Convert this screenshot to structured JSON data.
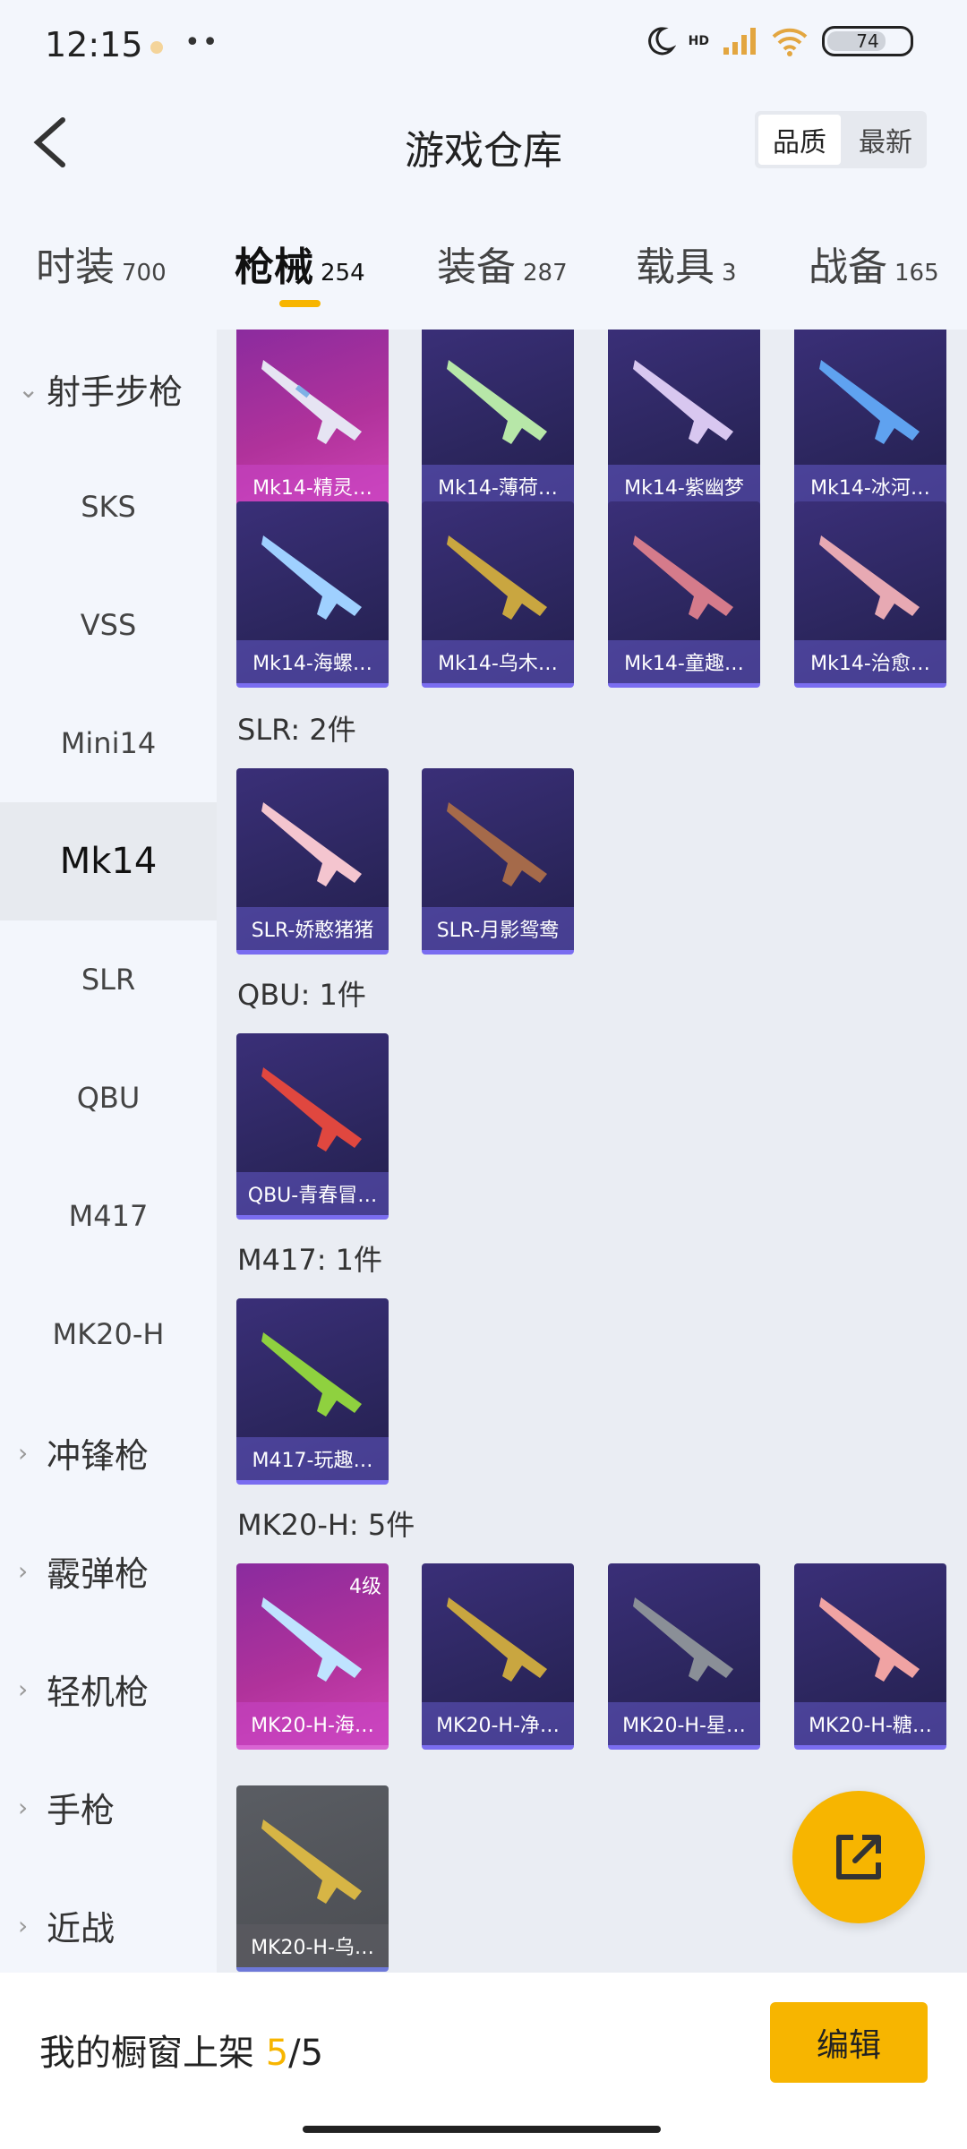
{
  "status_bar": {
    "time": "12:15",
    "network": "HD",
    "battery": "74",
    "battery_level": 0.74
  },
  "header": {
    "title": "游戏仓库",
    "sort_quality": "品质",
    "sort_latest": "最新"
  },
  "tabs": [
    {
      "label": "时装",
      "count": "700"
    },
    {
      "label": "枪械",
      "count": "254",
      "active": true
    },
    {
      "label": "装备",
      "count": "287"
    },
    {
      "label": "载具",
      "count": "3"
    },
    {
      "label": "战备",
      "count": "165"
    }
  ],
  "sidebar": {
    "group_sniper": "射手步枪",
    "items": [
      "SKS",
      "VSS",
      "Mini14",
      "Mk14",
      "SLR",
      "QBU",
      "M417",
      "MK20-H"
    ],
    "active_item": "Mk14",
    "groups": [
      "冲锋枪",
      "霰弹枪",
      "轻机枪",
      "手枪",
      "近战"
    ]
  },
  "content": {
    "mk14_row1": [
      "Mk14-精灵…",
      "Mk14-薄荷…",
      "Mk14-紫幽梦",
      "Mk14-冰河…"
    ],
    "mk14_row2": [
      "Mk14-海螺…",
      "Mk14-乌木…",
      "Mk14-童趣…",
      "Mk14-治愈…"
    ],
    "slr_title": "SLR: 2件",
    "slr": [
      "SLR-娇憨猪猪",
      "SLR-月影鸳鸯"
    ],
    "qbu_title": "QBU: 1件",
    "qbu": [
      "QBU-青春冒…"
    ],
    "m417_title": "M417: 1件",
    "m417": [
      "M417-玩趣…"
    ],
    "mk20_title": "MK20-H: 5件",
    "mk20": [
      "MK20-H-海…",
      "MK20-H-净…",
      "MK20-H-星…",
      "MK20-H-糖…",
      "MK20-H-乌…"
    ],
    "mk20_badge": "4级"
  },
  "bottom_bar": {
    "showcase_label": "我的橱窗上架",
    "showcase_count": "5",
    "showcase_sep": "/",
    "showcase_total": "5",
    "edit_label": "编辑"
  },
  "colors": {
    "accent": "#f7b500",
    "card_purple": "#2d2760",
    "card_pink": "#b0329b",
    "card_grey": "#4b4d52"
  }
}
